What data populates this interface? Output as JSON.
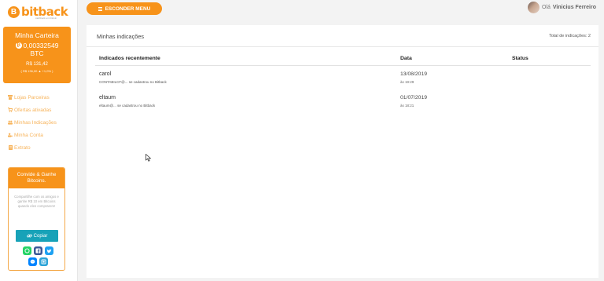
{
  "brand": {
    "name": "bitback",
    "coin_symbol": "B",
    "tagline": "cashback em bitcoin",
    "color": "#f7931a"
  },
  "wallet": {
    "title": "Minha Carteira",
    "btc_amount": "0,00332549",
    "btc_unit": "BTC",
    "brl_amount": "R$ 131,42",
    "rate": "( R$ 136,00 ▲ +1,0% )"
  },
  "nav": {
    "items": [
      {
        "label": "Lojas Parceiras",
        "icon": "store-icon"
      },
      {
        "label": "Ofertas ativadas",
        "icon": "cart-icon"
      },
      {
        "label": "Minhas Indicações",
        "icon": "users-icon"
      },
      {
        "label": "Minha Conta",
        "icon": "user-gear-icon"
      },
      {
        "label": "Extrato",
        "icon": "document-icon"
      }
    ]
  },
  "invite": {
    "title": "Convide & Ganhe Bitcoins.",
    "body": "Compartilhe com os amigos e ganhe R$ 10 em Bitcoins quando eles comprarem!",
    "copy_label": "Copiar",
    "share_colors": {
      "whatsapp": "#25d366",
      "facebook": "#3b5998",
      "twitter": "#1da1f2",
      "messenger": "#0084ff",
      "telegram": "#2aa3d8"
    }
  },
  "topbar": {
    "menu_button": "ESCONDER MENU",
    "greeting": "Olá",
    "user_name": "Vinicius Ferreiro"
  },
  "referrals": {
    "title": "Minhas indicações",
    "total": "Total de indicações: 2",
    "columns": [
      "Indicados recentemente",
      "Data",
      "Status"
    ],
    "rows": [
      {
        "name": "carol",
        "desc": "CONTABILCF@... se cadastrou no Bitback",
        "date": "13/08/2019",
        "time": "às 19:29",
        "status": ""
      },
      {
        "name": "eltaum",
        "desc": "eltaum@... se cadastrou no Bitback",
        "date": "01/07/2019",
        "time": "às 18:21",
        "status": ""
      }
    ]
  }
}
